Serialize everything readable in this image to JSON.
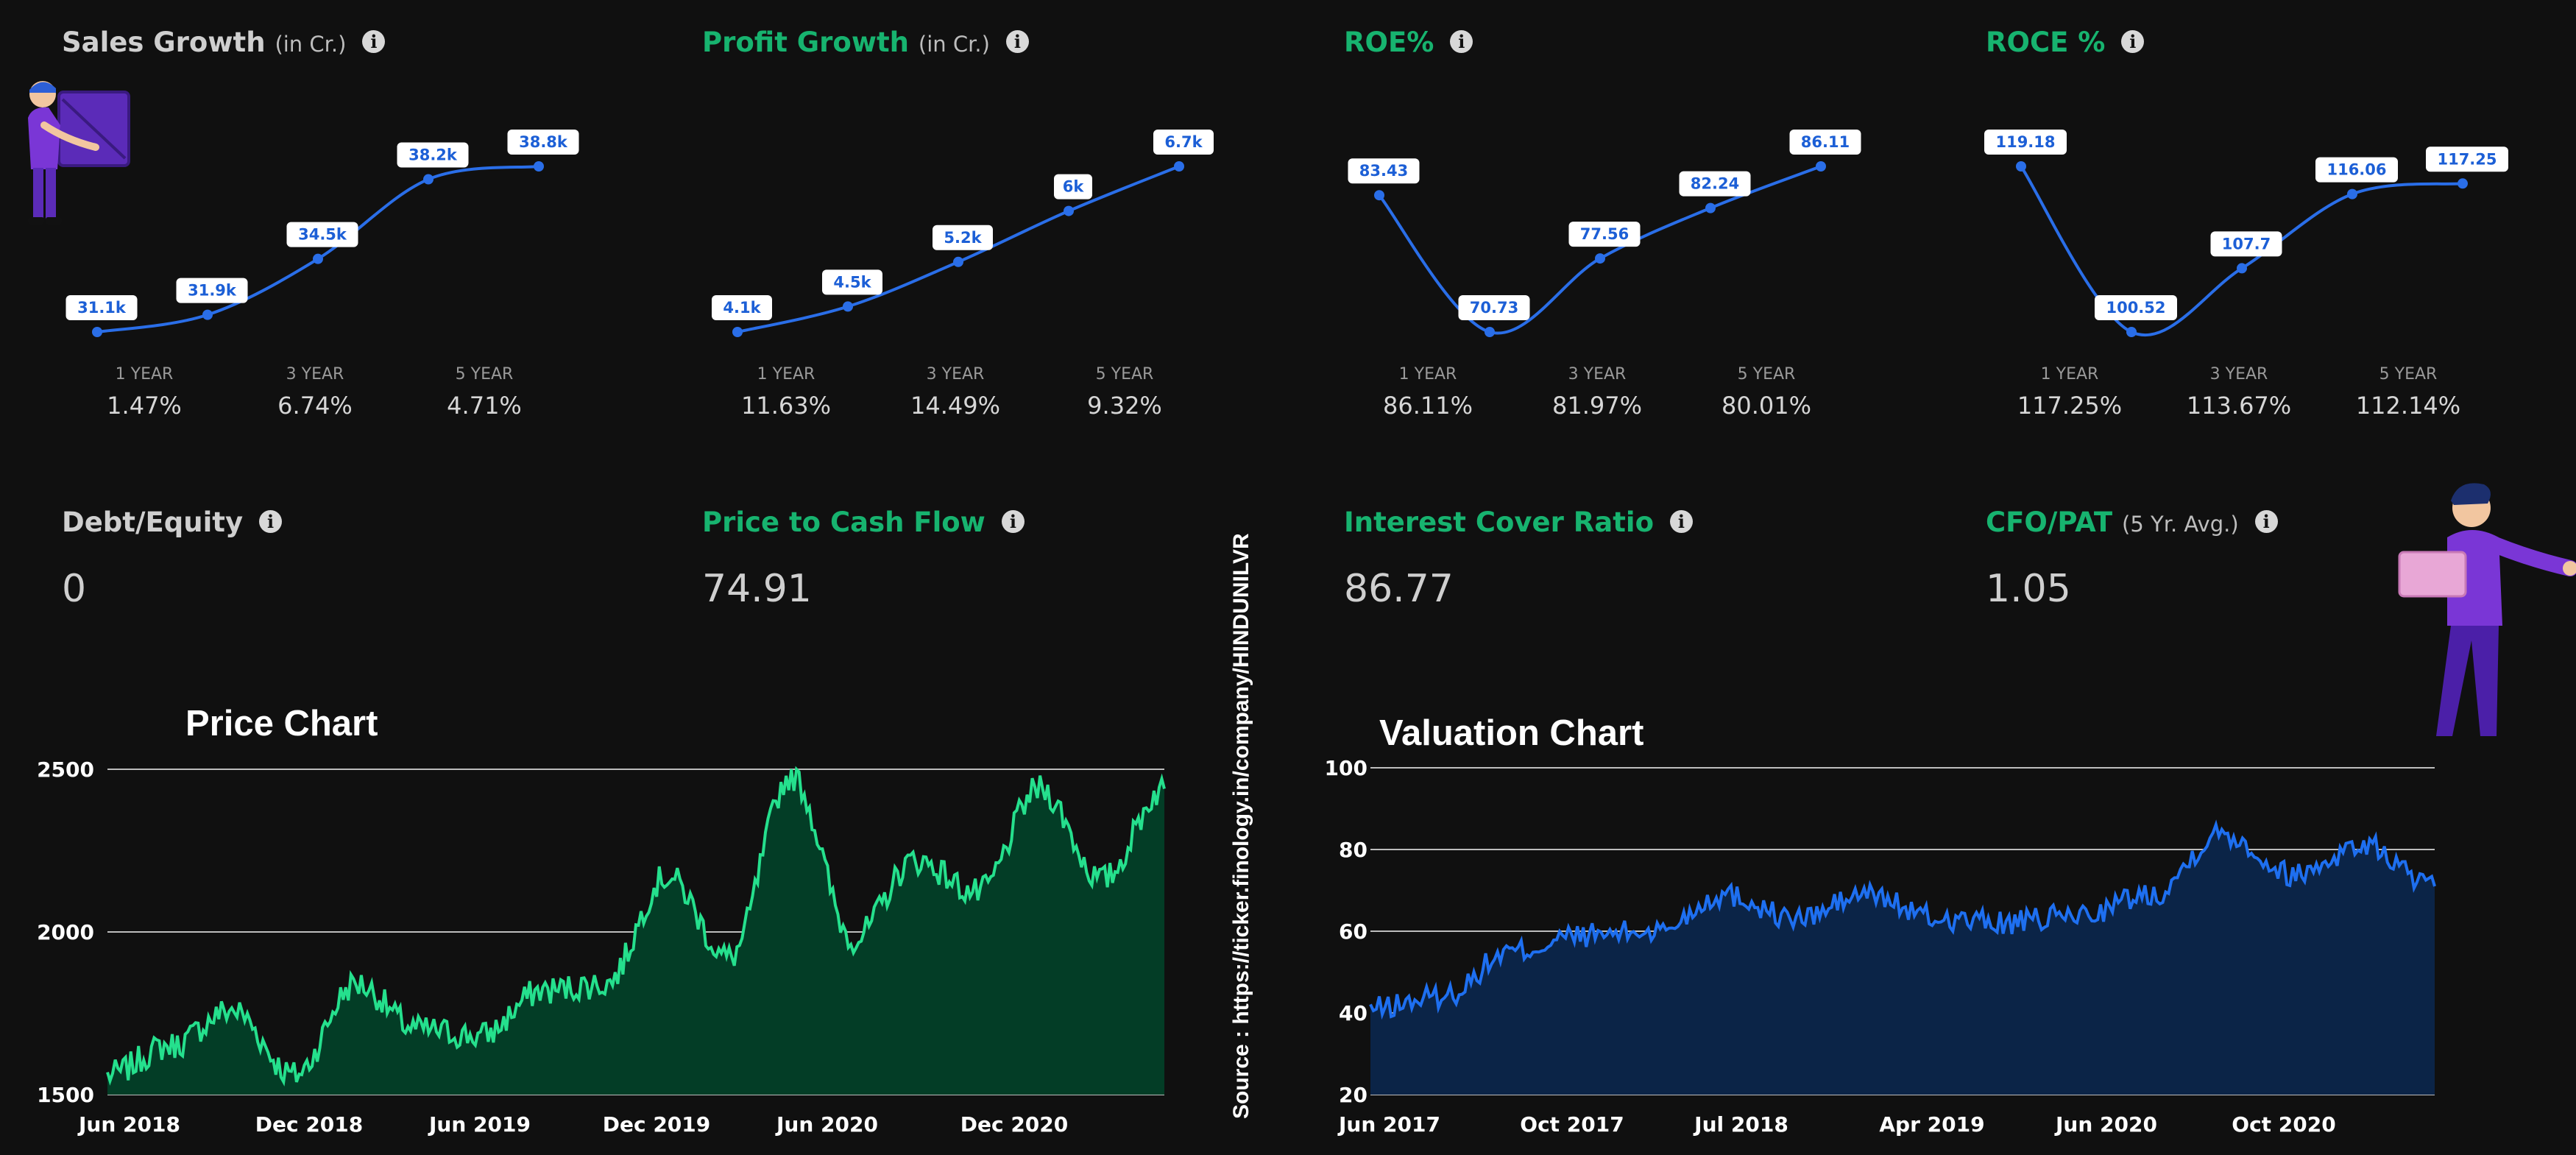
{
  "metrics": [
    {
      "title": "Sales Growth",
      "unit": "(in Cr.)",
      "color": "gray",
      "points": [
        "31.1k",
        "31.9k",
        "34.5k",
        "38.2k",
        "38.8k"
      ],
      "values": [
        31.1,
        31.9,
        34.5,
        38.2,
        38.8
      ],
      "periods": [
        {
          "label": "1 YEAR",
          "value": "1.47%"
        },
        {
          "label": "3 YEAR",
          "value": "6.74%"
        },
        {
          "label": "5 YEAR",
          "value": "4.71%"
        }
      ]
    },
    {
      "title": "Profit Growth",
      "unit": "(in Cr.)",
      "color": "green",
      "points": [
        "4.1k",
        "4.5k",
        "5.2k",
        "6k",
        "6.7k"
      ],
      "values": [
        4.1,
        4.5,
        5.2,
        6.0,
        6.7
      ],
      "periods": [
        {
          "label": "1 YEAR",
          "value": "11.63%"
        },
        {
          "label": "3 YEAR",
          "value": "14.49%"
        },
        {
          "label": "5 YEAR",
          "value": "9.32%"
        }
      ]
    },
    {
      "title": "ROE%",
      "unit": "",
      "color": "green",
      "points": [
        "83.43",
        "70.73",
        "77.56",
        "82.24",
        "86.11"
      ],
      "values": [
        83.43,
        70.73,
        77.56,
        82.24,
        86.11
      ],
      "periods": [
        {
          "label": "1 YEAR",
          "value": "86.11%"
        },
        {
          "label": "3 YEAR",
          "value": "81.97%"
        },
        {
          "label": "5 YEAR",
          "value": "80.01%"
        }
      ]
    },
    {
      "title": "ROCE %",
      "unit": "",
      "color": "green",
      "points": [
        "119.18",
        "100.52",
        "107.7",
        "116.06",
        "117.25"
      ],
      "values": [
        119.18,
        100.52,
        107.7,
        116.06,
        117.25
      ],
      "periods": [
        {
          "label": "1 YEAR",
          "value": "117.25%"
        },
        {
          "label": "3 YEAR",
          "value": "113.67%"
        },
        {
          "label": "5 YEAR",
          "value": "112.14%"
        }
      ]
    }
  ],
  "stats": [
    {
      "title": "Debt/Equity",
      "unit": "",
      "value": "0",
      "color": "gray"
    },
    {
      "title": "Price to Cash Flow",
      "unit": "",
      "value": "74.91",
      "color": "green"
    },
    {
      "title": "Interest Cover Ratio",
      "unit": "",
      "value": "86.77",
      "color": "green"
    },
    {
      "title": "CFO/PAT",
      "unit": "(5 Yr. Avg.)",
      "value": "1.05",
      "color": "green"
    }
  ],
  "info_glyph": "i",
  "source": "Source : https://ticker.finology.in/company/HINDUNILVR",
  "colors": {
    "background": "#101010",
    "green_line": "#25e08d",
    "green_fill": "#033d26",
    "blue_line": "#1e6ff0",
    "blue_fill": "#0b2447",
    "point": "#2a6ee8",
    "accent_green": "#17b36f"
  },
  "chart_data": [
    {
      "type": "area",
      "title": "Price Chart",
      "ylim": [
        1500,
        2500
      ],
      "yticks": [
        1500,
        2000,
        2500
      ],
      "xticks": [
        "Jun 2018",
        "Dec 2018",
        "Jun 2019",
        "Dec 2019",
        "Jun 2020",
        "Dec 2020"
      ],
      "x": [
        "Jun 2018",
        "Aug 2018",
        "Oct 2018",
        "Dec 2018",
        "Feb 2019",
        "Apr 2019",
        "Jun 2019",
        "Aug 2019",
        "Oct 2019",
        "Dec 2019",
        "Feb 2020",
        "Apr 2020",
        "Jun 2020",
        "Aug 2020",
        "Oct 2020",
        "Dec 2020",
        "Feb 2021",
        "Apr 2021"
      ],
      "values": [
        1560,
        1650,
        1760,
        1560,
        1840,
        1700,
        1680,
        1820,
        1840,
        2170,
        1920,
        2480,
        1980,
        2220,
        2120,
        2440,
        2160,
        2440
      ]
    },
    {
      "type": "area",
      "title": "Valuation Chart",
      "ylim": [
        20,
        100
      ],
      "yticks": [
        20,
        40,
        60,
        80,
        100
      ],
      "xticks": [
        "Jun 2017",
        "Oct 2017",
        "Jul 2018",
        "Apr 2019",
        "Jun 2020",
        "Oct 2020"
      ],
      "x": [
        "Jun 2017",
        "Sep 2017",
        "Dec 2017",
        "Mar 2018",
        "Jun 2018",
        "Sep 2018",
        "Dec 2018",
        "Mar 2019",
        "Jun 2019",
        "Sep 2019",
        "Dec 2019",
        "Mar 2020",
        "Jun 2020",
        "Sep 2020",
        "Dec 2020",
        "Mar 2021"
      ],
      "values": [
        41,
        44,
        55,
        59,
        60,
        69,
        63,
        69,
        63,
        62,
        64,
        69,
        84,
        74,
        81,
        71
      ]
    }
  ]
}
